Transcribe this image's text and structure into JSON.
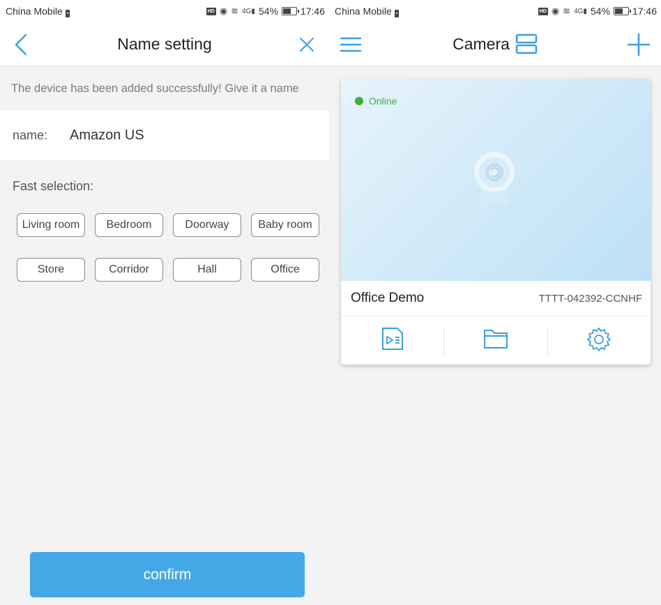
{
  "status_bar": {
    "carrier": "China Mobile",
    "hd": "HD",
    "signal": "4G",
    "battery": "54%",
    "battery_level": 0.54,
    "time": "17:46"
  },
  "name_setting": {
    "title": "Name setting",
    "banner": "The device has been added successfully! Give it a name",
    "name_label": "name:",
    "name_value": "Amazon US",
    "fast_selection_label": "Fast selection:",
    "chips": [
      "Living room",
      "Bedroom",
      "Doorway",
      "Baby room",
      "Store",
      "Corridor",
      "Hall",
      "Office"
    ],
    "confirm_label": "confirm"
  },
  "camera_list": {
    "title": "Camera",
    "devices": [
      {
        "status": "Online",
        "name": "Office Demo",
        "id": "TTTT-042392-CCNHF"
      }
    ]
  },
  "colors": {
    "accent": "#45a8e6",
    "online": "#3fae3c"
  },
  "icons": [
    "back-arrow-icon",
    "close-icon",
    "menu-icon",
    "layout-toggle-icon",
    "add-icon",
    "playback-icon",
    "folder-icon",
    "gear-icon",
    "camera-icon"
  ]
}
